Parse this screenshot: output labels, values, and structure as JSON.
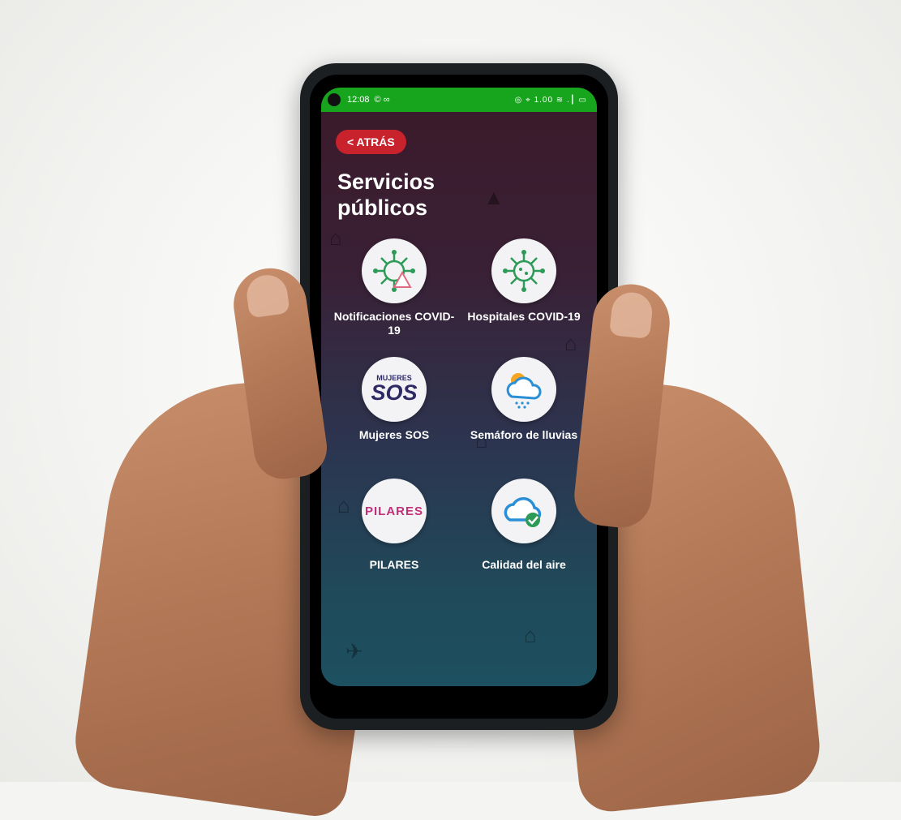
{
  "status_bar": {
    "time": "12:08",
    "left_icons": "© ∞",
    "right_icons": "◎ ⌖ 1.00 ≋ .┃ ▭"
  },
  "header": {
    "back_label": "< ATRÁS",
    "title": "Servicios públicos"
  },
  "services": [
    {
      "label": "Notificaciones COVID-19",
      "icon": "virus-warning-icon"
    },
    {
      "label": "Hospitales COVID-19",
      "icon": "virus-icon"
    },
    {
      "label": "Mujeres SOS",
      "icon": "mujeres-sos-logo",
      "logo_top": "MUJERES",
      "logo_main": "SOS"
    },
    {
      "label": "Semáforo de lluvias",
      "icon": "rain-cloud-icon"
    },
    {
      "label": "PILARES",
      "icon": "pilares-logo",
      "logo_text": "PILARES"
    },
    {
      "label": "Calidad del aire",
      "icon": "cloud-check-icon"
    }
  ],
  "colors": {
    "status_bar": "#17a51e",
    "back_button": "#c8232c",
    "virus_green": "#2e9a57",
    "logo_navy": "#2d2a66"
  }
}
